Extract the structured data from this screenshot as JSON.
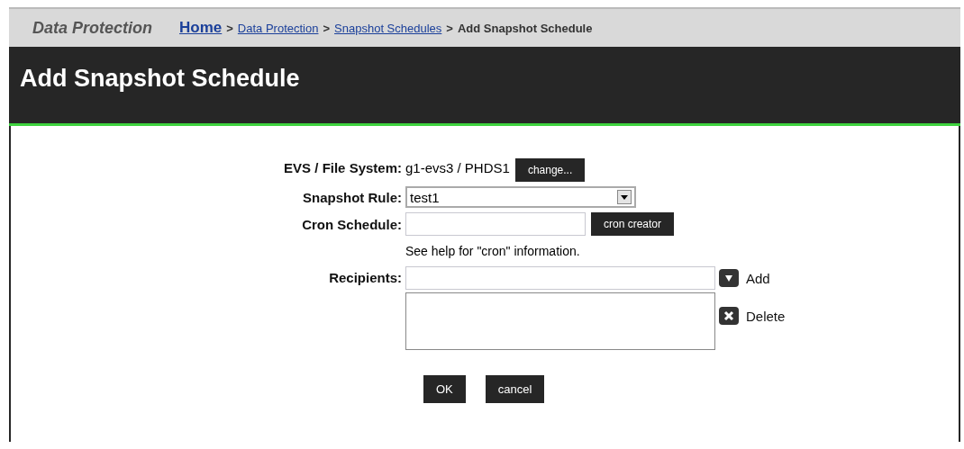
{
  "section_title": "Data Protection",
  "breadcrumb": {
    "links": [
      "Home",
      "Data Protection",
      "Snapshot Schedules"
    ],
    "separator": ">",
    "current": "Add Snapshot Schedule"
  },
  "page_title": "Add Snapshot Schedule",
  "form": {
    "evs_label": "EVS / File System:",
    "evs_value": "g1-evs3 /  PHDS1",
    "change_button": "change...",
    "rule_label": "Snapshot Rule:",
    "rule_value": "test1",
    "cron_label": "Cron Schedule:",
    "cron_button": "cron creator",
    "cron_help": "See help for \"cron\" information.",
    "recipients_label": "Recipients:",
    "add_button": "Add",
    "delete_button": "Delete"
  },
  "buttons": [
    "OK",
    "cancel"
  ]
}
